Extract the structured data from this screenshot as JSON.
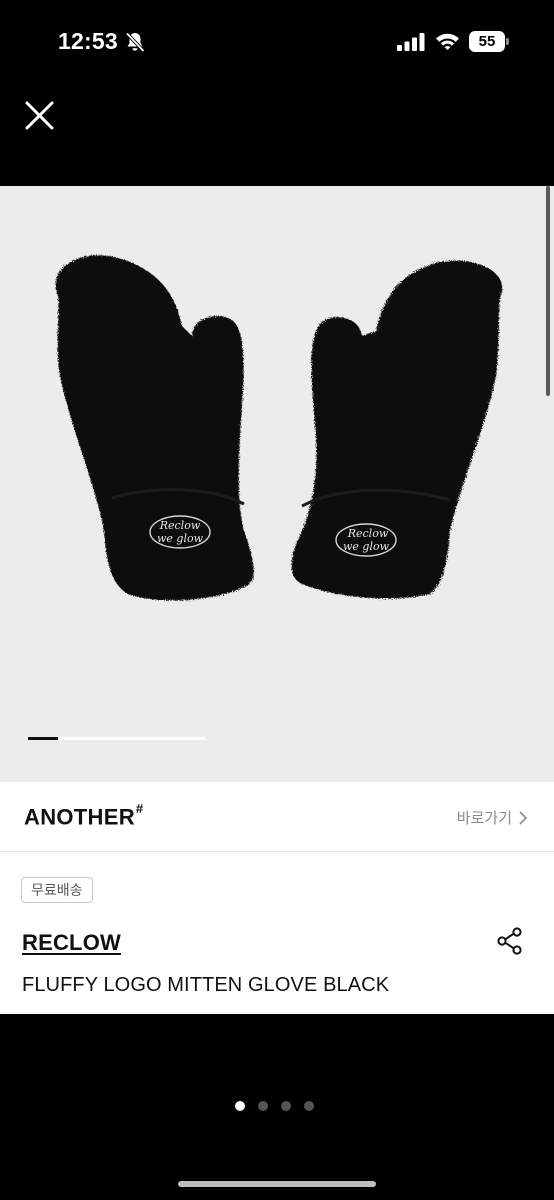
{
  "status_bar": {
    "time": "12:53",
    "battery": "55",
    "icons": [
      "bell-slash-icon",
      "signal-icon",
      "wifi-icon",
      "battery-icon"
    ]
  },
  "toolbar": {
    "close_icon": "close-icon"
  },
  "image": {
    "description_icon": "product-photo",
    "carousel_progress": 0.17,
    "mitten_label_line1": "Reclow",
    "mitten_label_line2": "we glow"
  },
  "shop": {
    "brand_logo": "ANOTHER",
    "brand_logo_mark": "#",
    "goto_label": "바로가기"
  },
  "product": {
    "badge": "무료배송",
    "seller": "RECLOW",
    "title": "FLUFFY LOGO MITTEN GLOVE BLACK"
  },
  "pager": {
    "count": 4,
    "active": 0
  },
  "colors": {
    "background": "#000000",
    "panel": "#ffffff",
    "image_bg": "#ececec",
    "muted": "#8a8a8a"
  }
}
